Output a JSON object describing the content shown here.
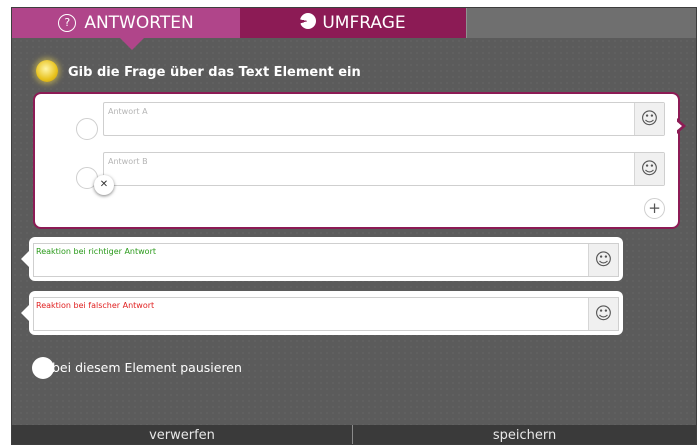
{
  "tabs": [
    {
      "label": "ANTWORTEN",
      "icon": "question-circle-icon",
      "active": true
    },
    {
      "label": "UMFRAGE",
      "icon": "pie-chart-icon",
      "active": false
    }
  ],
  "hint": {
    "text": "Gib die Frage über das Text Element ein",
    "icon": "lightbulb-icon"
  },
  "answers": [
    {
      "placeholder": "Antwort A"
    },
    {
      "placeholder": "Antwort B"
    }
  ],
  "icons": {
    "smiley": "☺",
    "remove": "✕",
    "add": "+",
    "question": "?"
  },
  "reactions": {
    "correct": {
      "text": "Reaktion bei richtiger Antwort",
      "color": "#2a9a1a"
    },
    "wrong": {
      "text": "Reaktion bei falscher Antwort",
      "color": "#e02020"
    }
  },
  "pause_label": "bei diesem Element pausieren",
  "footer": {
    "discard": "verwerfen",
    "save": "speichern"
  },
  "colors": {
    "tab_active": "#b0458a",
    "tab_secondary": "#8c1b55",
    "panel": "#5b5b5b"
  }
}
